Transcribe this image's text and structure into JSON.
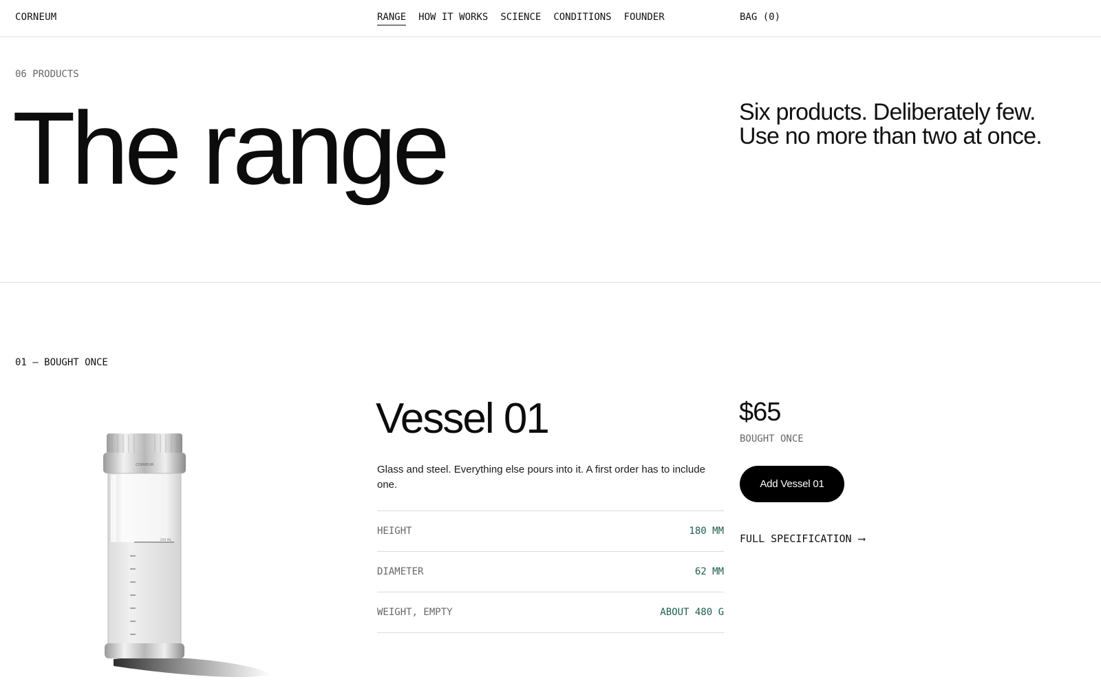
{
  "header": {
    "brand": "CORNEUM",
    "nav": [
      "RANGE",
      "HOW IT WORKS",
      "SCIENCE",
      "CONDITIONS",
      "FOUNDER"
    ],
    "active_nav": "RANGE",
    "bag": "BAG (0)"
  },
  "hero": {
    "count": "06 PRODUCTS",
    "title": "The range",
    "tagline_line1": "Six products. Deliberately few.",
    "tagline_line2": "Use no more than two at once."
  },
  "product": {
    "section_label": "01 — BOUGHT ONCE",
    "name": "Vessel 01",
    "description": "Glass and steel. Everything else pours into it. A first order has to include one.",
    "specs": [
      {
        "label": "HEIGHT",
        "value": "180 MM"
      },
      {
        "label": "DIAMETER",
        "value": "62 MM"
      },
      {
        "label": "WEIGHT, EMPTY",
        "value": "ABOUT 480 G"
      }
    ],
    "price": "$65",
    "price_note": "BOUGHT ONCE",
    "add_button": "Add Vessel 01",
    "spec_link": "FULL SPECIFICATION",
    "spec_link_arrow": "⟶",
    "image_alt_icon": "vessel-bottle-image",
    "bottle_label": "CORNEUM",
    "bottle_mark": "200 ML"
  },
  "colors": {
    "background": "#ffffff",
    "text": "#111111",
    "muted": "#666666",
    "spec_value": "#1d5c4f",
    "button": "#000000"
  }
}
